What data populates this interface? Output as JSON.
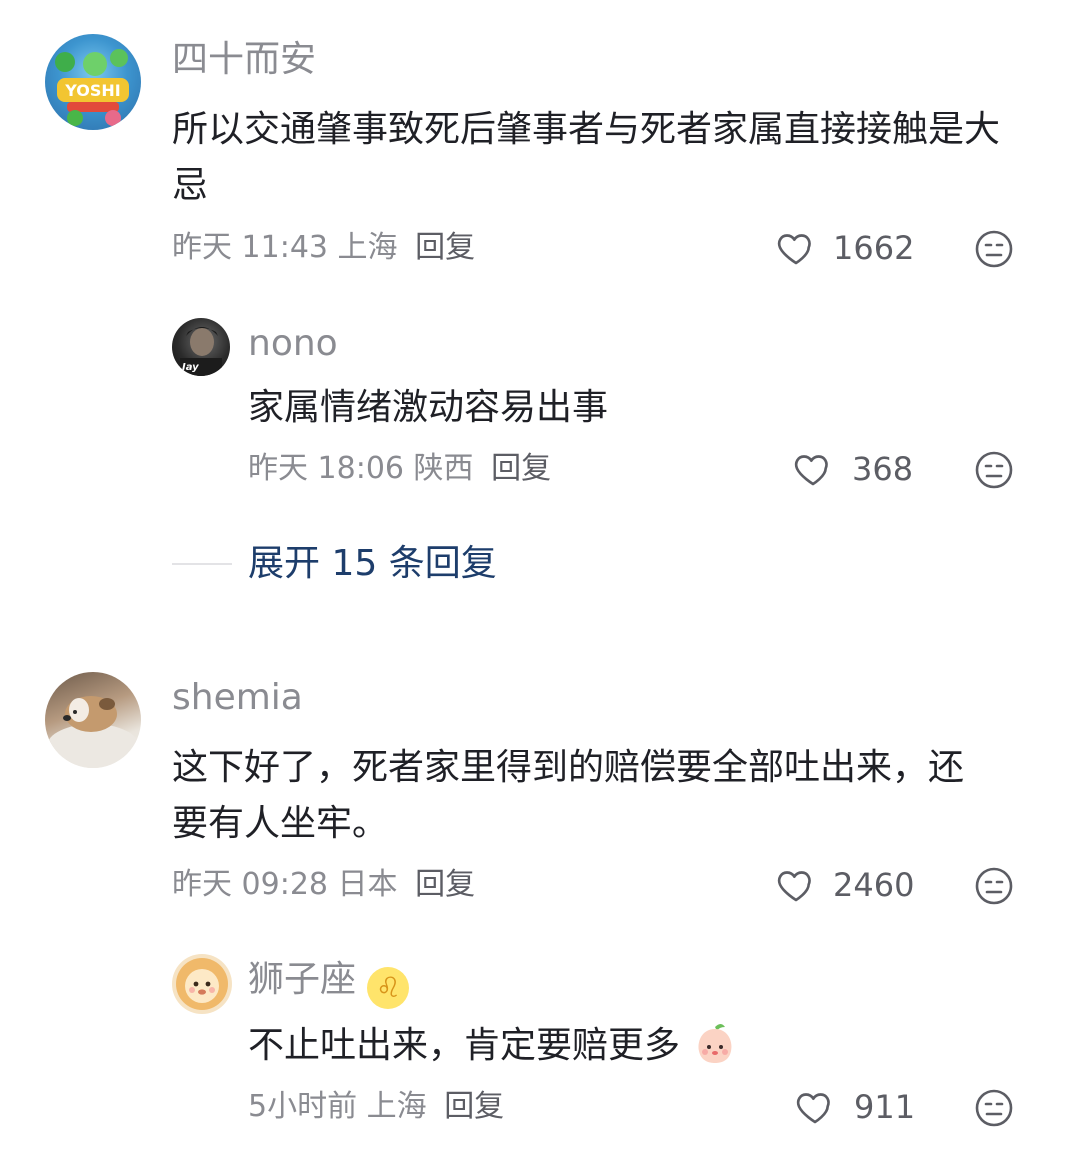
{
  "comments": [
    {
      "user": "四十而安",
      "text": "所以交通肇事致死后肇事者与死者家属直接接触是大忌",
      "time": "昨天 11:43",
      "location": "上海",
      "reply_label": "回复",
      "likes": "1662",
      "replies": [
        {
          "user": "nono",
          "text": "家属情绪激动容易出事",
          "time": "昨天 18:06",
          "location": "陕西",
          "reply_label": "回复",
          "likes": "368",
          "avatar_badge": "Jay"
        }
      ],
      "expand_label": "展开 15 条回复"
    },
    {
      "user": "shemia",
      "text": "这下好了，死者家里得到的赔偿要全部吐出来，还要有人坐牢。",
      "time": "昨天 09:28",
      "location": "日本",
      "reply_label": "回复",
      "likes": "2460",
      "replies": [
        {
          "user": "狮子座",
          "user_emoji": "♌",
          "text": "不止吐出来，肯定要赔更多",
          "time": "5小时前",
          "location": "上海",
          "reply_label": "回复",
          "likes": "911"
        }
      ]
    }
  ],
  "icons": {
    "like": "heart-outline-icon",
    "dislike": "meh-face-icon"
  }
}
